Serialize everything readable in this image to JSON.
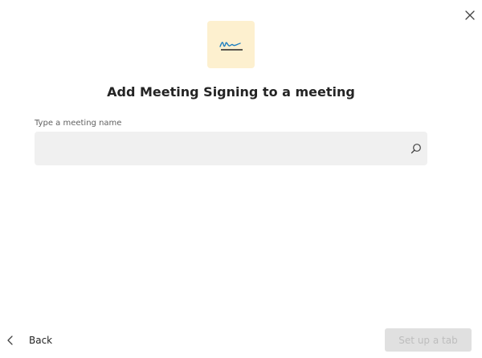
{
  "dialog": {
    "title": "Add Meeting Signing to a meeting",
    "app_icon": "signature-icon",
    "icon_bg_color": "#fdf0cf",
    "close_icon": "close-icon"
  },
  "meeting_name_field": {
    "label": "Type a meeting name",
    "value": "",
    "placeholder": "",
    "icon": "search-icon"
  },
  "footer": {
    "back_label": "Back",
    "back_icon": "chevron-left-icon",
    "primary_label": "Set up a tab",
    "primary_state": "disabled"
  }
}
